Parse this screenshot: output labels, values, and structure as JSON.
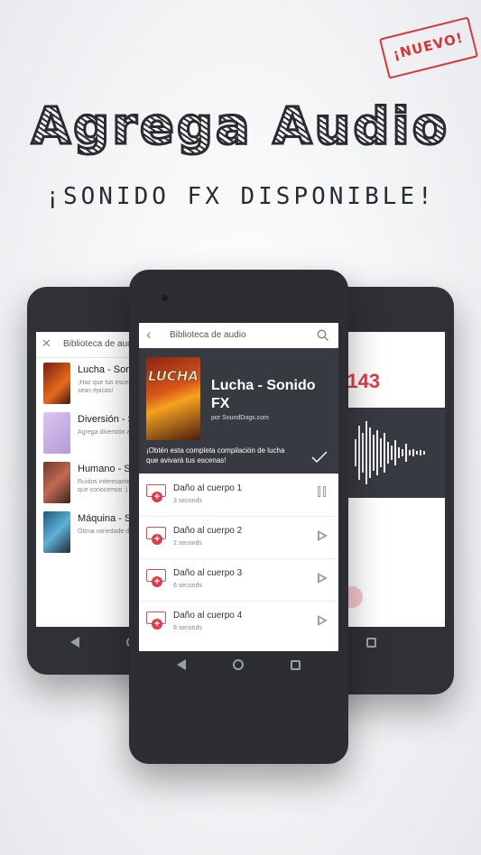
{
  "badge": "¡NUEVO!",
  "headline": "Agrega Audio",
  "subheadline": "¡SONIDO FX DISPONIBLE!",
  "colors": {
    "accent": "#e23b4a",
    "dark": "#383a41"
  },
  "left_phone": {
    "header_title": "Biblioteca de audio",
    "items": [
      {
        "title": "Lucha - Sonido FX",
        "desc": "¡Haz que tus escenas sean épicas!"
      },
      {
        "title": "Diversión - Sonido FX",
        "desc": "Agrega diversión a tus"
      },
      {
        "title": "Humano - Sonido FX",
        "desc": "Ruidos interesantes que conocemos :)"
      },
      {
        "title": "Máquina - Sonido FX",
        "desc": "Ótima variedade de"
      }
    ]
  },
  "right_phone": {
    "counter": "3.143"
  },
  "center_phone": {
    "header_title": "Biblioteca de audio",
    "album": {
      "cover_text": "LUCHA",
      "title": "Lucha - Sonido FX",
      "by": "por SoundDogs.com",
      "desc": "¡Obtén esta completa compilación de lucha que avivará tus escenas!"
    },
    "tracks": [
      {
        "name": "Daño al cuerpo 1",
        "duration": "3 seconds",
        "state": "paused"
      },
      {
        "name": "Daño al cuerpo 2",
        "duration": "2 seconds",
        "state": "play"
      },
      {
        "name": "Daño al cuerpo 3",
        "duration": "6 seconds",
        "state": "play"
      },
      {
        "name": "Daño al cuerpo 4",
        "duration": "8 seconds",
        "state": "play"
      }
    ]
  }
}
